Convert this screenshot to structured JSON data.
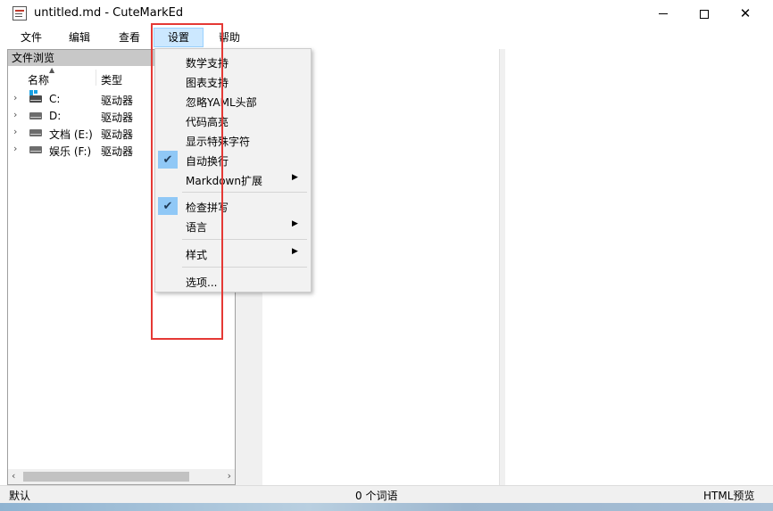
{
  "window": {
    "title": "untitled.md - CuteMarkEd",
    "minimize_label": "–",
    "maximize_label": "□",
    "close_label": "✕"
  },
  "menubar": {
    "file": "文件",
    "edit": "编辑",
    "view": "查看",
    "settings": "设置",
    "help": "帮助"
  },
  "file_browser": {
    "title": "文件浏览",
    "columns": {
      "name": "名称",
      "type": "类型"
    },
    "items": [
      {
        "name": "C:",
        "type": "驱动器",
        "icon": "system-drive-icon"
      },
      {
        "name": "D:",
        "type": "驱动器",
        "icon": "drive-icon"
      },
      {
        "name": "文档 (E:)",
        "type": "驱动器",
        "icon": "drive-icon"
      },
      {
        "name": "娱乐 (F:)",
        "type": "驱动器",
        "icon": "drive-icon"
      }
    ]
  },
  "settings_menu": {
    "math_support": "数学支持",
    "diagram_support": "图表支持",
    "ignore_yaml": "忽略YAML头部",
    "code_highlight": "代码高亮",
    "show_special_chars": "显示特殊字符",
    "word_wrap": "自动换行",
    "markdown_ext": "Markdown扩展",
    "spell_check": "检查拼写",
    "language": "语言",
    "style": "样式",
    "options": "选项..."
  },
  "statusbar": {
    "left": "默认",
    "words": "0 个词语",
    "right": "HTML预览"
  },
  "colors": {
    "highlight_border": "#e53935",
    "menu_active_bg": "#cce8ff",
    "check_bg": "#90c8f6"
  }
}
